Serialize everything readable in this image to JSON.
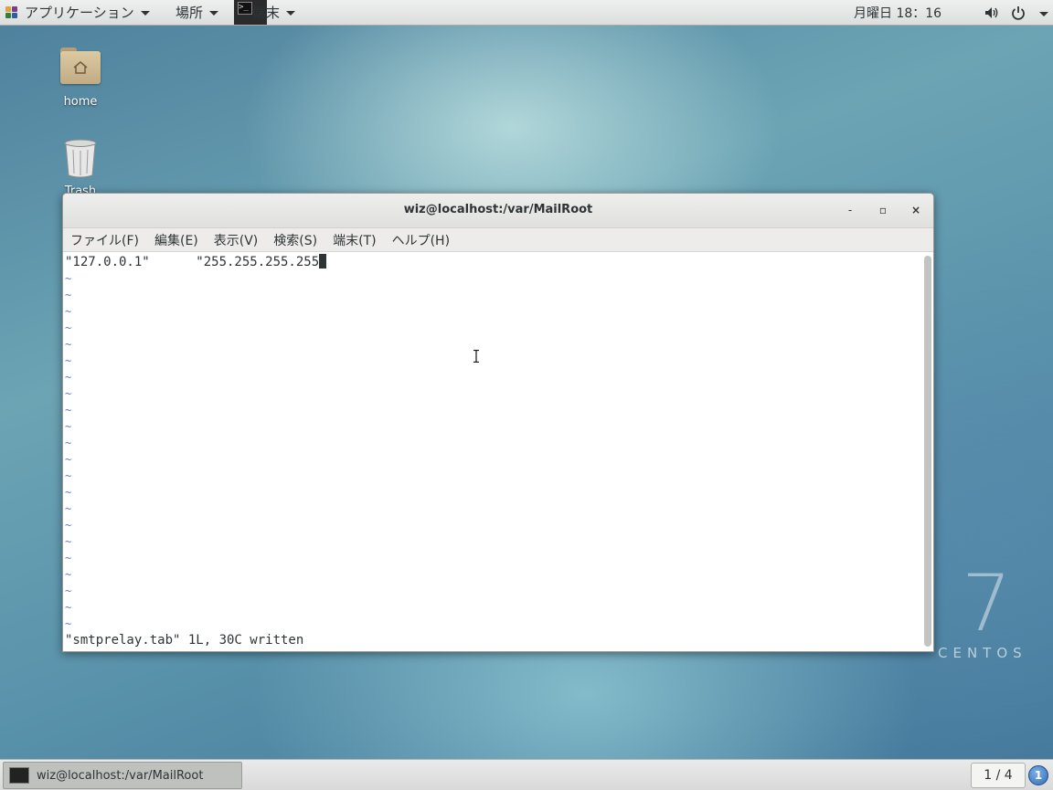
{
  "topbar": {
    "applications_label": "アプリケーション",
    "places_label": "場所",
    "terminal_label": "端末",
    "clock": "月曜日 18：16"
  },
  "desktop": {
    "home_label": "home",
    "trash_label": "Trash"
  },
  "window": {
    "title": "wiz@localhost:/var/MailRoot",
    "minimize": "-",
    "maximize": "▫",
    "close": "×",
    "menus": [
      "ファイル(F)",
      "編集(E)",
      "表示(V)",
      "検索(S)",
      "端末(T)",
      "ヘルプ(H)"
    ],
    "editor": {
      "line1": "\"127.0.0.1\"      \"255.255.255.255",
      "tilde": "~",
      "status": "\"smtprelay.tab\" 1L, 30C written"
    }
  },
  "branding": {
    "number": "7",
    "word": "CENTOS"
  },
  "taskbar": {
    "task_label": "wiz@localhost:/var/MailRoot",
    "workspace": "1 / 4",
    "notifications": "1"
  },
  "colors": {
    "tilde": "#5a7fc6",
    "desktop_base": "#5a93ab"
  }
}
